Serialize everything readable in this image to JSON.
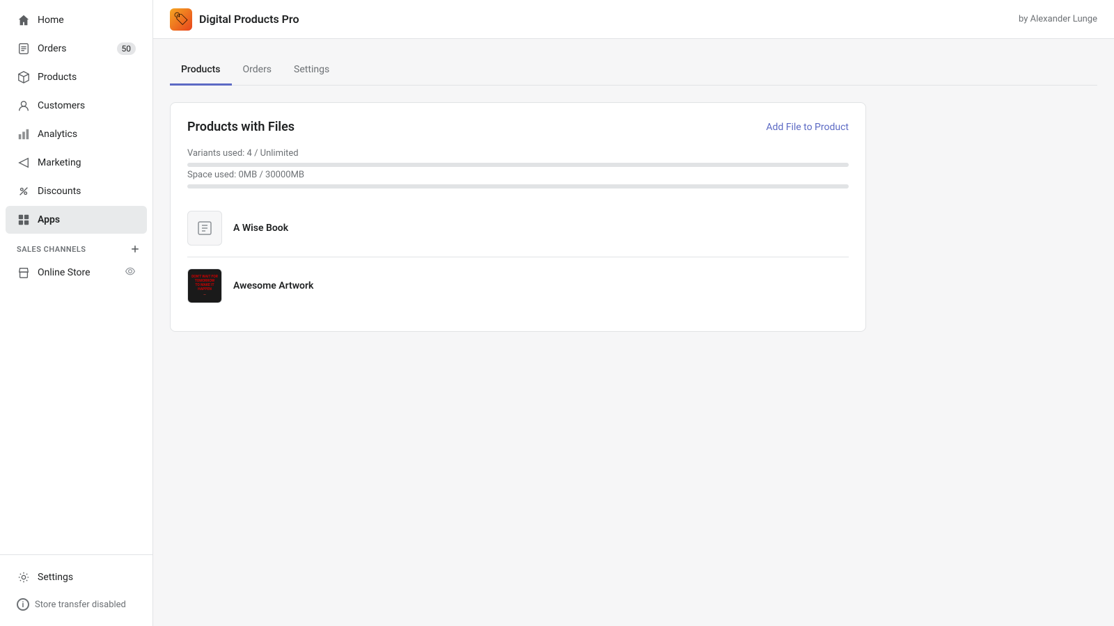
{
  "sidebar": {
    "items": [
      {
        "id": "home",
        "label": "Home",
        "icon": "home",
        "badge": null,
        "active": false
      },
      {
        "id": "orders",
        "label": "Orders",
        "icon": "orders",
        "badge": "50",
        "active": false
      },
      {
        "id": "products",
        "label": "Products",
        "icon": "products",
        "badge": null,
        "active": false
      },
      {
        "id": "customers",
        "label": "Customers",
        "icon": "customers",
        "badge": null,
        "active": false
      },
      {
        "id": "analytics",
        "label": "Analytics",
        "icon": "analytics",
        "badge": null,
        "active": false
      },
      {
        "id": "marketing",
        "label": "Marketing",
        "icon": "marketing",
        "badge": null,
        "active": false
      },
      {
        "id": "discounts",
        "label": "Discounts",
        "icon": "discounts",
        "badge": null,
        "active": false
      },
      {
        "id": "apps",
        "label": "Apps",
        "icon": "apps",
        "badge": null,
        "active": true
      }
    ],
    "sales_channels_label": "SALES CHANNELS",
    "sales_channels": [
      {
        "id": "online-store",
        "label": "Online Store",
        "icon": "store"
      }
    ],
    "footer": {
      "settings_label": "Settings",
      "store_transfer_label": "Store transfer disabled"
    }
  },
  "app_header": {
    "logo_emoji": "🏷",
    "title": "Digital Products Pro",
    "author": "by Alexander Lunge"
  },
  "tabs": [
    {
      "id": "products",
      "label": "Products",
      "active": true
    },
    {
      "id": "orders",
      "label": "Orders",
      "active": false
    },
    {
      "id": "settings",
      "label": "Settings",
      "active": false
    }
  ],
  "products_card": {
    "title": "Products with Files",
    "add_file_label": "Add File to Product",
    "variants_used_label": "Variants used: 4 / Unlimited",
    "space_used_label": "Space used: 0MB / 30000MB",
    "progress_percent": 0,
    "products": [
      {
        "id": "wise-book",
        "name": "A Wise Book",
        "has_image": false
      },
      {
        "id": "awesome-artwork",
        "name": "Awesome Artwork",
        "has_image": true
      }
    ]
  }
}
